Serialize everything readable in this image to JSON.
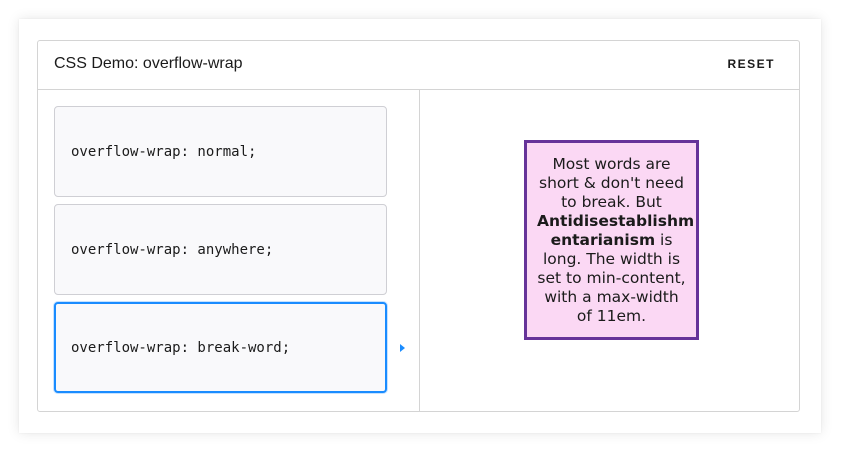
{
  "header": {
    "title": "CSS Demo: overflow-wrap",
    "reset_label": "RESET"
  },
  "options": [
    {
      "code": "overflow-wrap: normal;",
      "selected": false
    },
    {
      "code": "overflow-wrap: anywhere;",
      "selected": false
    },
    {
      "code": "overflow-wrap: break-word;",
      "selected": true
    }
  ],
  "output": {
    "lines": [
      {
        "text": "Most words are",
        "bold": false
      },
      {
        "text": "short & don't need",
        "bold": false
      },
      {
        "text": "to break. But",
        "bold": false
      },
      {
        "text": "Antidisestablishm",
        "bold": true
      },
      {
        "bold_part": "entarianism",
        "rest": " is"
      },
      {
        "text": "long. The width is",
        "bold": false
      },
      {
        "text": "set to min-content,",
        "bold": false
      },
      {
        "text": "with a max-width",
        "bold": false
      },
      {
        "text": "of 11em.",
        "bold": false
      }
    ]
  },
  "colors": {
    "accent": "#1a8cff",
    "output_background": "#fbd8f4",
    "output_border": "#663399",
    "option_background": "#f9f9fb"
  }
}
